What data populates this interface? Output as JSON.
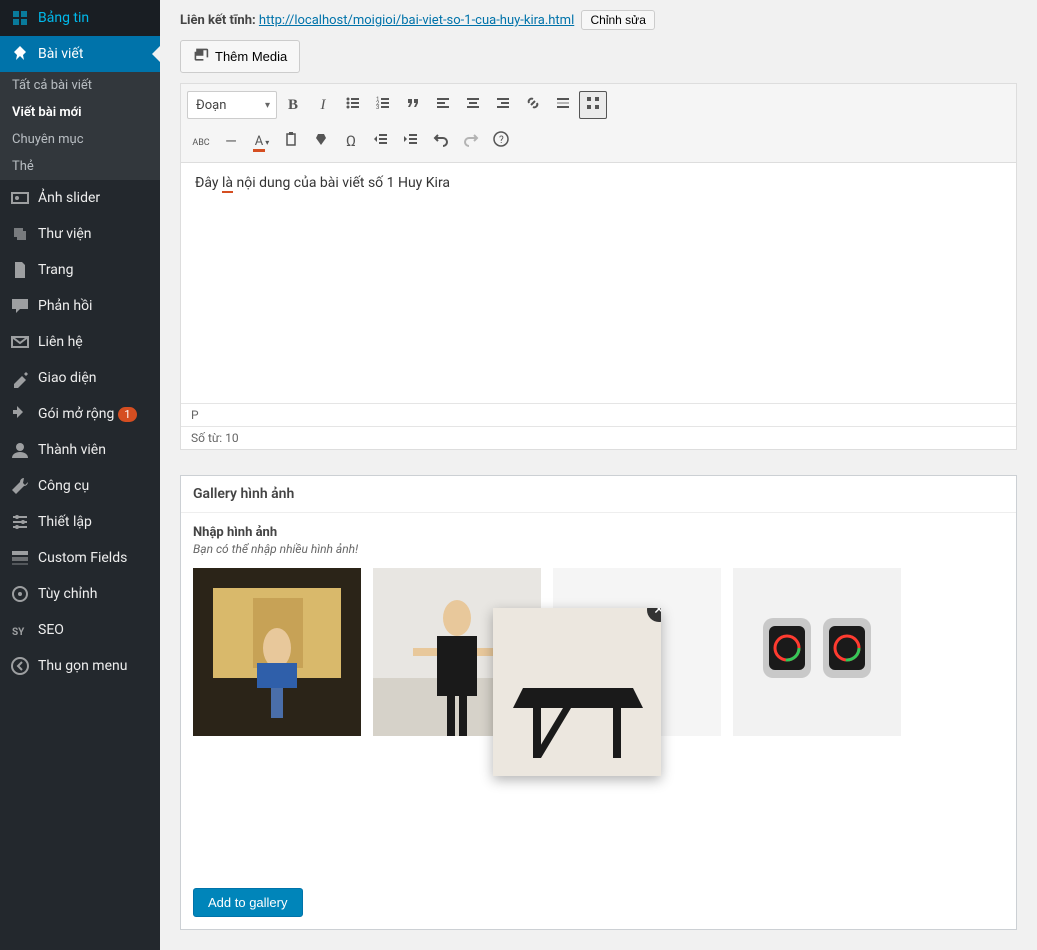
{
  "sidebar": {
    "items": [
      {
        "icon": "dashboard",
        "label": "Bảng tin"
      },
      {
        "icon": "pin",
        "label": "Bài viết",
        "active": true,
        "sub": [
          {
            "label": "Tất cả bài viết"
          },
          {
            "label": "Viết bài mới",
            "current": true
          },
          {
            "label": "Chuyên mục"
          },
          {
            "label": "Thẻ"
          }
        ]
      },
      {
        "icon": "slider",
        "label": "Ảnh slider"
      },
      {
        "icon": "media",
        "label": "Thư viện"
      },
      {
        "icon": "page",
        "label": "Trang"
      },
      {
        "icon": "comment",
        "label": "Phản hồi"
      },
      {
        "icon": "mail",
        "label": "Liên hệ"
      },
      {
        "icon": "appearance",
        "label": "Giao diện"
      },
      {
        "icon": "plugin",
        "label": "Gói mở rộng",
        "badge": "1"
      },
      {
        "icon": "user",
        "label": "Thành viên"
      },
      {
        "icon": "tools",
        "label": "Công cụ"
      },
      {
        "icon": "settings",
        "label": "Thiết lập"
      },
      {
        "icon": "fields",
        "label": "Custom Fields"
      },
      {
        "icon": "customize",
        "label": "Tùy chỉnh"
      },
      {
        "icon": "seo",
        "label": "SEO"
      },
      {
        "icon": "collapse",
        "label": "Thu gọn menu"
      }
    ]
  },
  "permalink": {
    "label": "Liên kết tĩnh:",
    "url_prefix": "http://localhost/moigioi/",
    "url_slug": "bai-viet-so-1-cua-huy-kira",
    "url_suffix": ".html",
    "edit_btn": "Chỉnh sửa"
  },
  "editor": {
    "add_media": "Thêm Media",
    "format_select": "Đoạn",
    "row1": [
      "bold",
      "italic",
      "ul",
      "ol",
      "quote",
      "align-left",
      "align-center",
      "align-right",
      "link",
      "more",
      "kitchen-sink"
    ],
    "row2": [
      "abc",
      "strike",
      "text-color",
      "paste",
      "clear",
      "omega",
      "outdent",
      "indent",
      "undo",
      "redo",
      "help"
    ],
    "content_pre": "Đây ",
    "content_err": "là",
    "content_post": " nội dung của bài viết số 1 Huy Kira",
    "path": "P",
    "wordcount": "Số từ: 10"
  },
  "gallery": {
    "title": "Gallery hình ảnh",
    "input_label": "Nhập hình ảnh",
    "hint": "Bạn có thể nhập nhiều hình ảnh!",
    "add_btn": "Add to gallery",
    "close": "✕"
  }
}
